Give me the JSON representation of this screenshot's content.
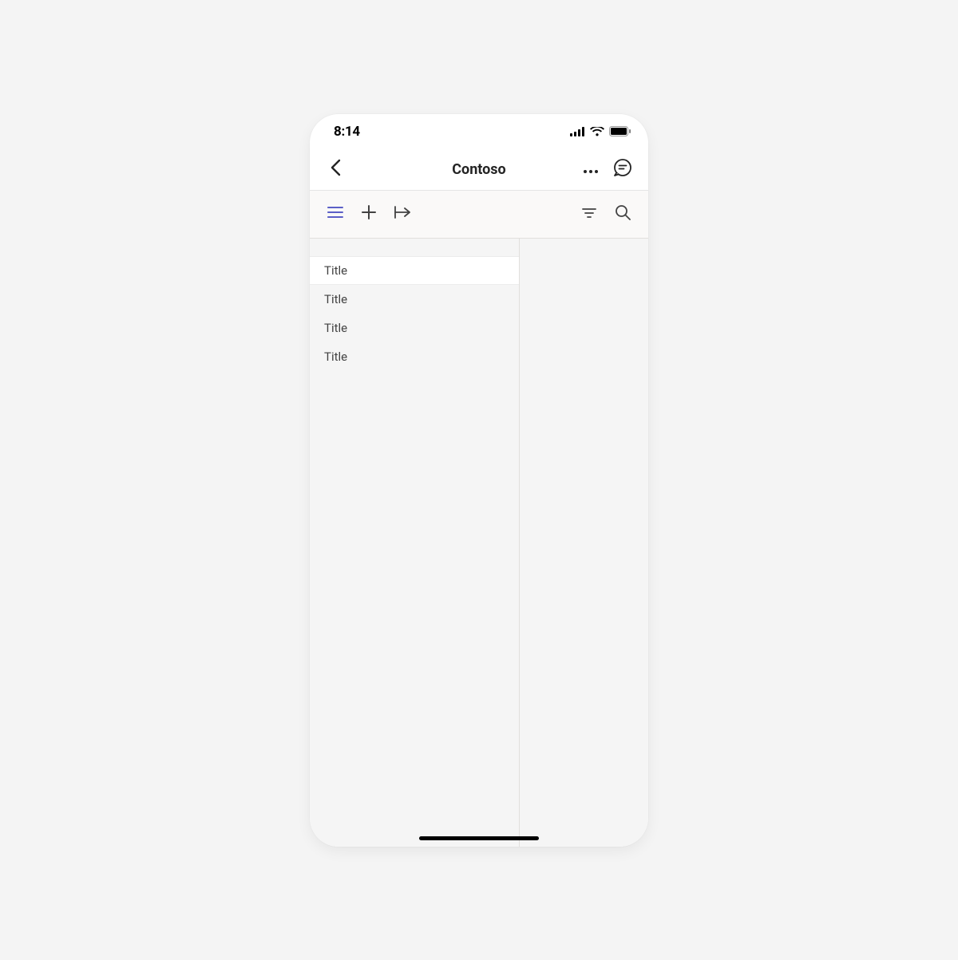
{
  "status": {
    "time": "8:14"
  },
  "header": {
    "title": "Contoso"
  },
  "list": {
    "items": [
      {
        "label": "Title",
        "selected": true
      },
      {
        "label": "Title",
        "selected": false
      },
      {
        "label": "Title",
        "selected": false
      },
      {
        "label": "Title",
        "selected": false
      }
    ]
  },
  "ui": {
    "accent": "#5b5fc7",
    "icons": {
      "back": "chevron-left",
      "more": "more-horizontal",
      "chat": "chat-bubble",
      "hamburger": "hamburger",
      "add": "plus",
      "export": "export-right",
      "filter": "filter",
      "search": "search"
    }
  }
}
